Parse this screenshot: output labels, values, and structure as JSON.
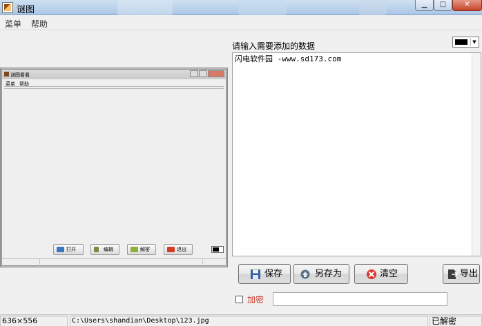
{
  "window": {
    "title": "谜图",
    "controls": {
      "minimize": "▁",
      "maximize": "□",
      "close": "✕"
    }
  },
  "menu": {
    "items": [
      "菜单",
      "帮助"
    ]
  },
  "preview": {
    "title": "谜图看看",
    "menu": [
      "菜单",
      "帮助"
    ],
    "buttons": [
      "打开",
      "编辑",
      "解密",
      "退出"
    ]
  },
  "editor": {
    "prompt": "请输入需要添加的数据",
    "text": "闪电软件园 -www.sd173.com",
    "color": "#000000"
  },
  "buttons": {
    "save": "保存",
    "save_as": "另存为",
    "clear": "清空",
    "export": "导出"
  },
  "encrypt": {
    "label": "加密",
    "checked": false,
    "password": ""
  },
  "status": {
    "size": "636×556",
    "path": "C:\\Users\\shandian\\Desktop\\123.jpg",
    "state": "已解密"
  },
  "icons": {
    "app": "app-icon",
    "save": "floppy-disk-icon",
    "save_as": "save-as-icon",
    "clear": "clear-x-icon",
    "export": "export-document-icon"
  }
}
